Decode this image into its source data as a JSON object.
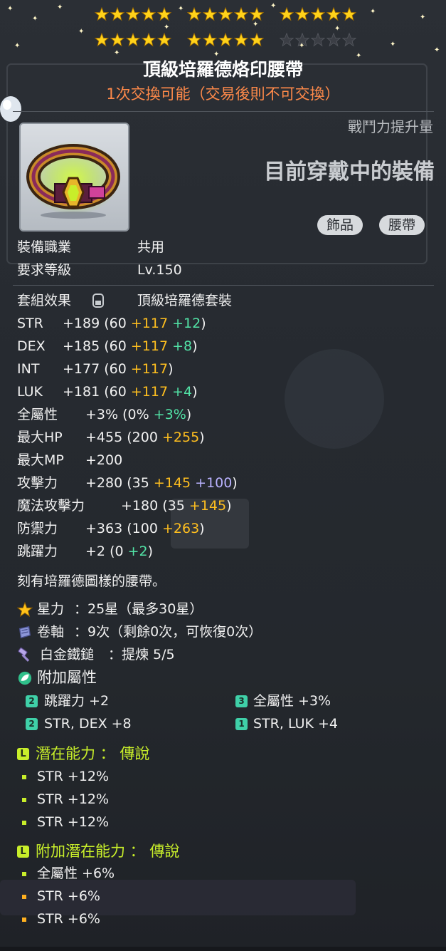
{
  "stars": {
    "filled": 25,
    "max": 30
  },
  "item": {
    "name": "頂級培羅德烙印腰帶",
    "trade_note": "1次交換可能（交易後則不可交換）",
    "combat_power_label": "戰鬥力提升量",
    "equipped_label": "目前穿戴中的裝備",
    "tags": [
      "飾品",
      "腰帶"
    ]
  },
  "requirements": [
    {
      "label": "裝備職業",
      "value": "共用"
    },
    {
      "label": "要求等級",
      "value": "Lv.150"
    }
  ],
  "set_effect": {
    "label": "套組效果",
    "value": "頂級培羅德套裝"
  },
  "stats": [
    {
      "name": "STR",
      "total": "+189",
      "open": "(60",
      "parts": [
        {
          "v": "+117",
          "c": "y"
        },
        {
          "v": "+12",
          "c": "g"
        }
      ],
      "close": ")"
    },
    {
      "name": "DEX",
      "total": "+185",
      "open": "(60",
      "parts": [
        {
          "v": "+117",
          "c": "y"
        },
        {
          "v": "+8",
          "c": "g"
        }
      ],
      "close": ")"
    },
    {
      "name": "INT",
      "total": "+177",
      "open": "(60",
      "parts": [
        {
          "v": "+117",
          "c": "y"
        }
      ],
      "close": ")"
    },
    {
      "name": "LUK",
      "total": "+181",
      "open": "(60",
      "parts": [
        {
          "v": "+117",
          "c": "y"
        },
        {
          "v": "+4",
          "c": "g"
        }
      ],
      "close": ")"
    },
    {
      "name": "全屬性",
      "total": "+3%",
      "open": "(0%",
      "parts": [
        {
          "v": "+3%",
          "c": "g"
        }
      ],
      "close": ")"
    },
    {
      "name": "最大HP",
      "total": "+455",
      "open": "(200",
      "parts": [
        {
          "v": "+255",
          "c": "y"
        }
      ],
      "close": ")"
    },
    {
      "name": "最大MP",
      "total": "+200",
      "open": "",
      "parts": [],
      "close": ""
    },
    {
      "name": "攻擊力",
      "total": "+280",
      "open": "(35",
      "parts": [
        {
          "v": "+145",
          "c": "y"
        },
        {
          "v": "+100",
          "c": "p"
        }
      ],
      "close": ")"
    },
    {
      "name": "魔法攻擊力",
      "total": "+180",
      "open": "(35",
      "parts": [
        {
          "v": "+145",
          "c": "y"
        }
      ],
      "close": ")"
    },
    {
      "name": "防禦力",
      "total": "+363",
      "open": "(100",
      "parts": [
        {
          "v": "+263",
          "c": "y"
        }
      ],
      "close": ")"
    },
    {
      "name": "跳躍力",
      "total": "+2",
      "open": "(0",
      "parts": [
        {
          "v": "+2",
          "c": "g"
        }
      ],
      "close": ")"
    }
  ],
  "description": "刻有培羅德圖樣的腰帶。",
  "enhance": {
    "starforce": {
      "label": "星力",
      "value": "：25星（最多30星）"
    },
    "scroll": {
      "label": "卷軸",
      "value": "：9次（剩餘0次，可恢復0次）"
    },
    "hammer": {
      "label": "白金鐵鎚",
      "value": "：提煉 5/5"
    }
  },
  "bonus": {
    "header": "附加屬性",
    "lines": [
      {
        "badge": "2",
        "text": "跳躍力 +2"
      },
      {
        "badge": "3",
        "text": "全屬性 +3%"
      },
      {
        "badge": "2",
        "text": "STR, DEX +8"
      },
      {
        "badge": "1",
        "text": "STR, LUK +4"
      }
    ]
  },
  "potential": {
    "header": "潛在能力 ： 傳說",
    "lines": [
      "STR +12%",
      "STR +12%",
      "STR +12%"
    ]
  },
  "additional_potential": {
    "header": "附加潛在能力 ： 傳說",
    "lines": [
      "全屬性 +6%",
      "STR +6%",
      "STR +6%"
    ]
  },
  "colors": {
    "gold": "#ffbf1f",
    "green": "#52e3a6",
    "purple": "#b9b2ff",
    "legend": "#c8ee2a",
    "trade": "#ff8a4a"
  },
  "icons": {
    "starforce": "star-icon",
    "scroll": "scroll-icon",
    "hammer": "hammer-icon",
    "bonus": "leaf-icon"
  }
}
